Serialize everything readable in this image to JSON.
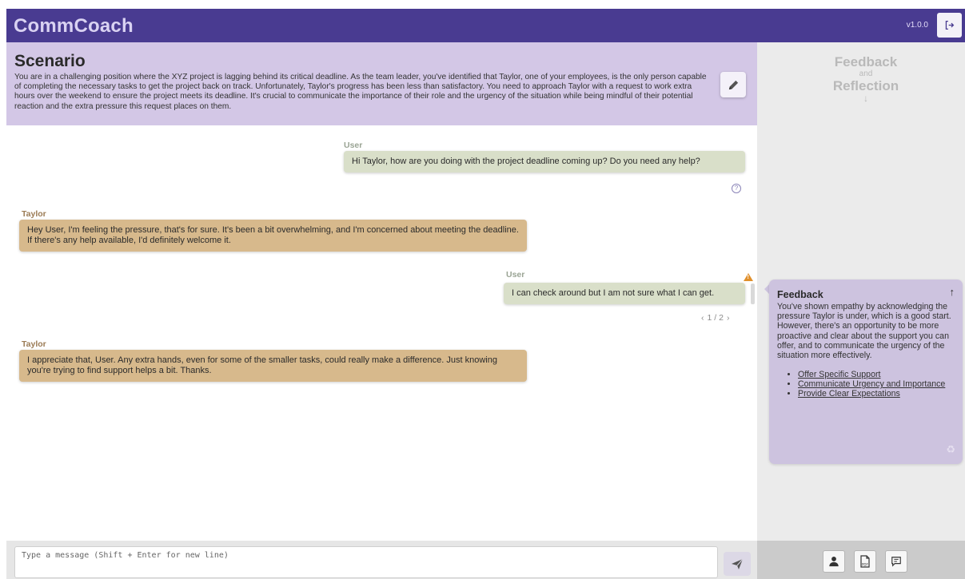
{
  "app": {
    "name": "CommCoach",
    "version": "v1.0.0"
  },
  "scenario": {
    "title": "Scenario",
    "text": "You are in a challenging position where the XYZ project is lagging behind its critical deadline. As the team leader, you've identified that Taylor, one of your employees, is the only person capable of completing the necessary tasks to get the project back on track. Unfortunately, Taylor's progress has been less than satisfactory. You need to approach Taylor with a request to work extra hours over the weekend to ensure the project meets its deadline. It's crucial to communicate the importance of their role and the urgency of the situation while being mindful of their potential reaction and the extra pressure this request places on them."
  },
  "messages": [
    {
      "sender": "User",
      "text": "Hi Taylor, how are you doing with the project deadline coming up? Do you need any help?"
    },
    {
      "sender": "Taylor",
      "text": "Hey User, I'm feeling the pressure, that's for sure. It's been a bit overwhelming, and I'm concerned about meeting the deadline. If there's any help available, I'd definitely welcome it."
    },
    {
      "sender": "User",
      "text": "I can check around but I am not sure what I can get.",
      "pager": "1 / 2",
      "flag": "warning"
    },
    {
      "sender": "Taylor",
      "text": "I appreciate that, User. Any extra hands, even for some of the smaller tasks, could really make a difference. Just knowing you're trying to find support helps a bit. Thanks."
    }
  ],
  "composer": {
    "placeholder": "Type a message (Shift + Enter for new line)"
  },
  "sidebar": {
    "heading_line1": "Feedback",
    "heading_and": "and",
    "heading_line2": "Reflection",
    "heading_arrow": "↓"
  },
  "feedback": {
    "title": "Feedback",
    "text": "You've shown empathy by acknowledging the pressure Taylor is under, which is a good start. However, there's an opportunity to be more proactive and clear about the support you can offer, and to communicate the urgency of the situation more effectively.",
    "items": [
      "Offer Specific Support",
      "Communicate Urgency and Importance",
      "Provide Clear Expectations"
    ]
  },
  "icons": {
    "logout": "logout-icon",
    "edit": "pencil-icon",
    "send": "send-icon",
    "help": "help-circle-icon",
    "warning": "warning-icon",
    "collapse": "arrow-up-icon",
    "recycle": "recycle-icon",
    "profile": "person-icon",
    "pdf": "pdf-icon",
    "notes": "chat-note-icon"
  },
  "colors": {
    "topbar": "#493b91",
    "scenario_bg": "#d3c7e6",
    "user_bubble": "#d9dfc9",
    "ai_bubble": "#d7b98c",
    "feedback_card": "#cdc3df",
    "warning": "#e0902c"
  }
}
